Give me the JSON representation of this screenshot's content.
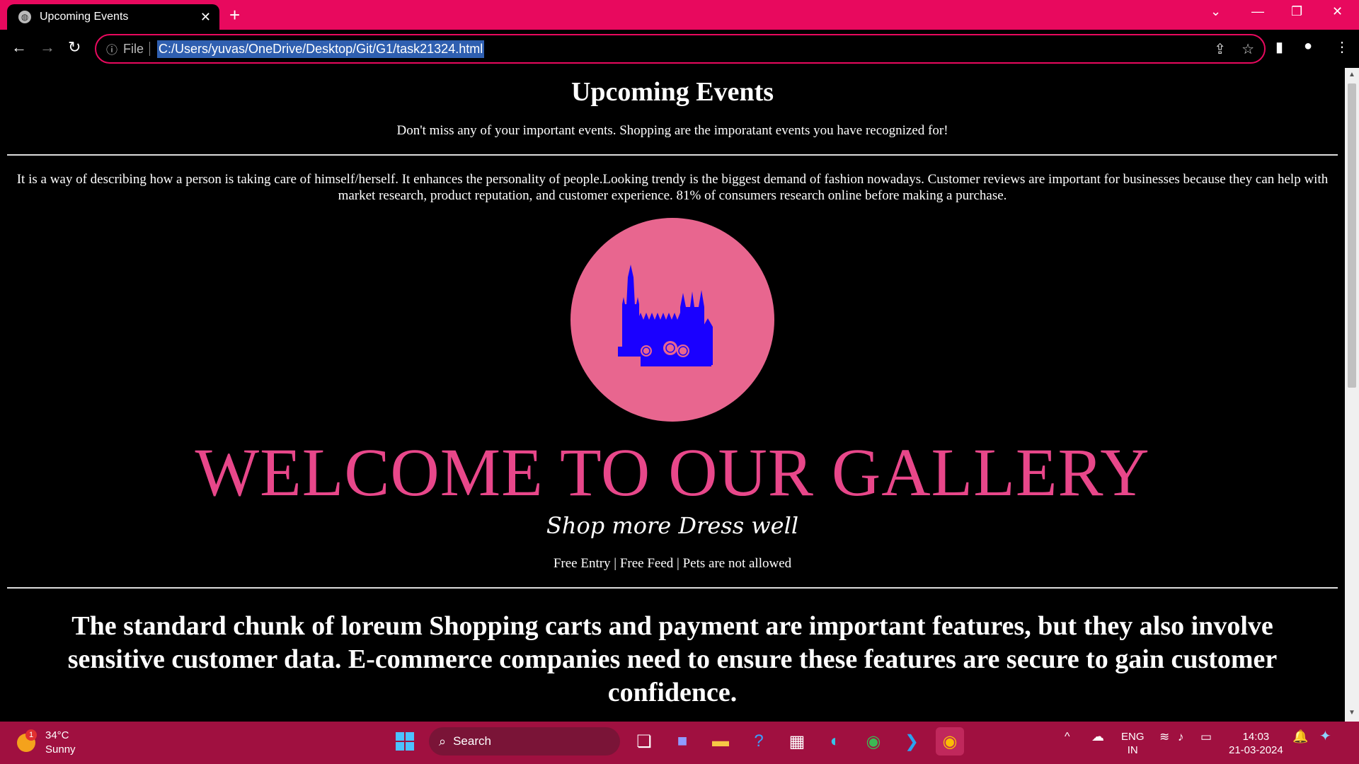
{
  "browser": {
    "tab_title": "Upcoming Events",
    "address_scheme": "File",
    "url": "C:/Users/yuvas/OneDrive/Desktop/Git/G1/task21324.html"
  },
  "page": {
    "heading": "Upcoming Events",
    "subtitle": "Don't miss any of your important events. Shopping are the imporatant events you have recognized for!",
    "paragraph": "It is a way of describing how a person is taking care of himself/herself. It enhances the personality of people.Looking trendy is the biggest demand of fashion nowadays. Customer reviews are important for businesses because they can help with market research, product reputation, and customer experience. 81% of consumers research online before making a purchase.",
    "gallery_title": "WELCOME TO OUR GALLERY",
    "tagline": "Shop more Dress well",
    "info_line": "Free Entry | Free Feed | Pets are not allowed",
    "big_paragraph": "The standard chunk of loreum Shopping carts and payment are important features, but they also involve sensitive customer data. E-commerce companies need to ensure these features are secure to gain customer confidence."
  },
  "taskbar": {
    "weather_temp": "34°C",
    "weather_desc": "Sunny",
    "weather_badge": "1",
    "search_label": "Search",
    "lang_top": "ENG",
    "lang_bottom": "IN",
    "time": "14:03",
    "date": "21-03-2024"
  },
  "colors": {
    "accent": "#e8095e",
    "logo_circle": "#e8668f",
    "gallery_text": "#e8478a",
    "castle": "#1a00ff",
    "taskbar": "#a01040"
  }
}
